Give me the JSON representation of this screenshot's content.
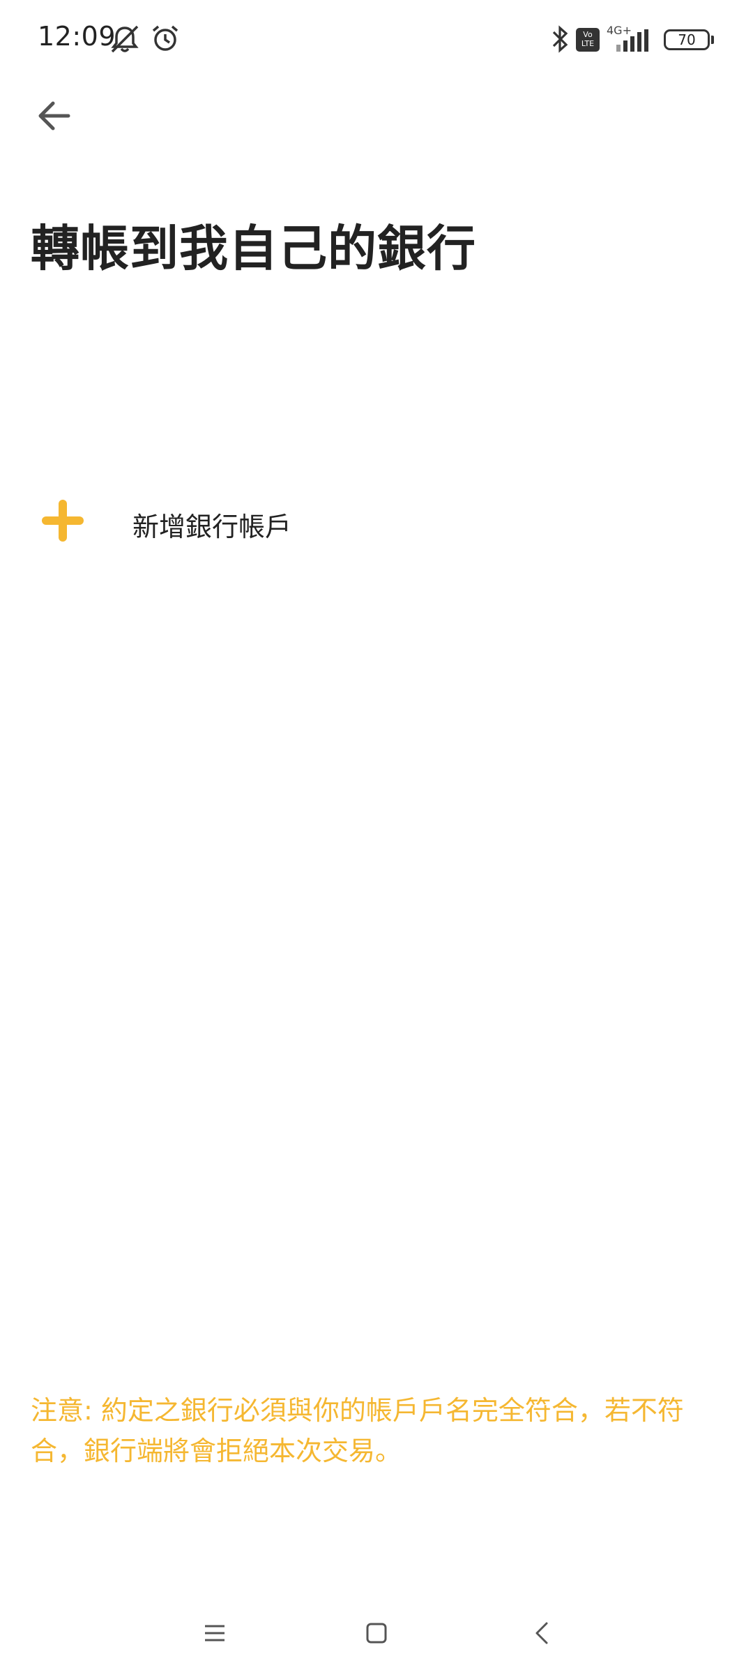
{
  "status_bar": {
    "time": "12:09",
    "network": "4G+",
    "volte": "Vo LTE",
    "battery": "70",
    "icons": [
      "bell-muted-icon",
      "alarm-icon",
      "bluetooth-icon",
      "volte-icon",
      "signal-icon",
      "battery-icon"
    ]
  },
  "header": {
    "back_icon": "arrow-left-icon",
    "title": "轉帳到我自己的銀行"
  },
  "actions": {
    "add_account_label": "新增銀行帳戶",
    "add_icon": "plus-icon"
  },
  "notice": {
    "text": "注意: 約定之銀行必須與你的帳戶戶名完全符合，若不符合，銀行端將會拒絕本次交易。"
  },
  "nav": {
    "icons": [
      "menu-icon",
      "home-square-icon",
      "back-chevron-icon"
    ]
  },
  "colors": {
    "accent": "#f5b731",
    "text": "#222222",
    "background": "#ffffff"
  }
}
